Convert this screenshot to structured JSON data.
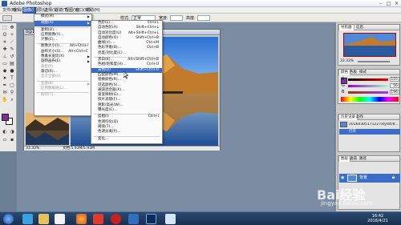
{
  "window": {
    "title": "Adobe Photoshop"
  },
  "menubar": {
    "items": [
      {
        "label": "文件(F)"
      },
      {
        "label": "编辑(E)"
      },
      {
        "label": "图像(I)"
      },
      {
        "label": "图层(L)"
      },
      {
        "label": "选择(S)"
      },
      {
        "label": "滤镜(T)"
      },
      {
        "label": "视图(V)"
      },
      {
        "label": "窗口(W)"
      },
      {
        "label": "帮助(H)"
      }
    ]
  },
  "options": {
    "style_label": "样式:",
    "style_value": "正常",
    "width_label": "宽度:",
    "height_label": "高度:"
  },
  "document": {
    "title": "0@100%(RGB/8)",
    "zoom": "33.33%",
    "doc_info": "文档:5.93M/5.93M"
  },
  "image_menu": {
    "items": [
      {
        "label": "模式(M)",
        "arrow": true
      },
      {
        "sep": true
      },
      {
        "label": "调整(A)",
        "arrow": true,
        "hl": true
      },
      {
        "sep": true
      },
      {
        "label": "复制(D)..."
      },
      {
        "label": "应用图像(Y)..."
      },
      {
        "label": "计算(C)..."
      },
      {
        "sep": true
      },
      {
        "label": "图像大小(I)...",
        "shortcut": "Alt+Ctrl+I"
      },
      {
        "label": "画布大小(S)...",
        "shortcut": "Alt+Ctrl+C"
      },
      {
        "label": "像素长宽比(X)",
        "arrow": true
      },
      {
        "label": "旋转画布(E)",
        "arrow": true
      },
      {
        "label": "裁剪(P)",
        "dim": true
      },
      {
        "label": "裁切(R)..."
      },
      {
        "label": "显示全部(V)",
        "dim": true
      },
      {
        "sep": true
      },
      {
        "label": "变量(B)",
        "arrow": true,
        "dim": true
      },
      {
        "label": "应用数据组(L)...",
        "dim": true
      },
      {
        "sep": true
      },
      {
        "label": "陷印(T)...",
        "dim": true
      }
    ]
  },
  "adjust_menu": {
    "items": [
      {
        "label": "色阶(L)...",
        "shortcut": "Ctrl+L"
      },
      {
        "label": "自动色阶(A)",
        "shortcut": "Shift+Ctrl+L"
      },
      {
        "label": "自动对比度(U)",
        "shortcut": "Alt+Shift+Ctrl+L"
      },
      {
        "label": "自动颜色(O)",
        "shortcut": "Shift+Ctrl+B"
      },
      {
        "label": "曲线(V)...",
        "shortcut": "Ctrl+M"
      },
      {
        "label": "色彩平衡(B)...",
        "shortcut": "Ctrl+B"
      },
      {
        "label": "亮度/对比度(C)..."
      },
      {
        "sep": true
      },
      {
        "label": "黑白(K)...",
        "shortcut": "Alt+Shift+Ctrl+B"
      },
      {
        "label": "色相/饱和度(H)...",
        "shortcut": "Ctrl+U"
      },
      {
        "label": "去色(D)",
        "shortcut": "Shift+Ctrl+U",
        "hl": true
      },
      {
        "label": "匹配颜色(M)..."
      },
      {
        "label": "替换颜色(R)..."
      },
      {
        "label": "可选颜色(S)..."
      },
      {
        "label": "通道混合器(X)..."
      },
      {
        "label": "渐变映射(G)..."
      },
      {
        "label": "照片滤镜(F)..."
      },
      {
        "label": "阴影/高光(W)..."
      },
      {
        "label": "曝光度(E)..."
      },
      {
        "sep": true
      },
      {
        "label": "反相(I)",
        "shortcut": "Ctrl+I"
      },
      {
        "label": "色调均化(Q)"
      },
      {
        "label": "阈值(T)..."
      },
      {
        "label": "色调分离(P)..."
      },
      {
        "sep": true
      },
      {
        "label": "变化..."
      }
    ]
  },
  "panels": {
    "navigator": {
      "tabs": [
        "导航器",
        "信息"
      ],
      "zoom": "33.33%"
    },
    "color": {
      "tabs": [
        "颜色",
        "色板",
        "样式"
      ],
      "r": "155",
      "g": "56",
      "b": "196",
      "r_label": "R",
      "g_label": "G",
      "b_label": "B"
    },
    "history": {
      "tabs": [
        "历史记录",
        "动作"
      ],
      "snapshot": "20160305171227xfyd4r8...",
      "step": "打开"
    },
    "layers": {
      "tabs": [
        "图层",
        "通道",
        "路径"
      ],
      "layer": "背景"
    }
  },
  "taskbar": {
    "time": "16:42",
    "date": "2016/4/21"
  },
  "watermark": {
    "text": "Bai经验",
    "sub": "jingyan.baidu.com"
  },
  "colors": {
    "highlight": "#3a6cc9",
    "foreground": "#7d2d9c"
  }
}
